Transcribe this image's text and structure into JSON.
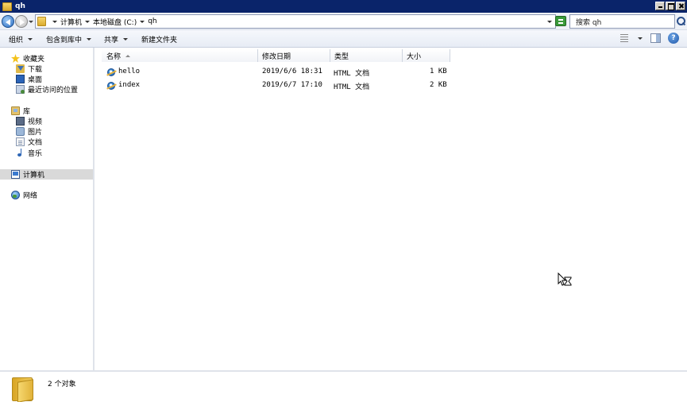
{
  "window": {
    "title": "qh"
  },
  "address": {
    "crumbs": [
      "计算机",
      "本地磁盘 (C:)",
      "qh"
    ]
  },
  "search": {
    "placeholder": "搜索 qh"
  },
  "toolbar": {
    "organize": "组织",
    "include_in_library": "包含到库中",
    "share": "共享",
    "new_folder": "新建文件夹",
    "help": "?"
  },
  "nav": {
    "favorites": "收藏夹",
    "downloads": "下载",
    "desktop": "桌面",
    "recent": "最近访问的位置",
    "libraries": "库",
    "videos": "视频",
    "pictures": "图片",
    "documents": "文档",
    "music": "音乐",
    "computer": "计算机",
    "network": "网络"
  },
  "columns": {
    "name": "名称",
    "date": "修改日期",
    "type": "类型",
    "size": "大小"
  },
  "files": [
    {
      "name": "hello",
      "date": "2019/6/6 18:31",
      "type": "HTML 文档",
      "size": "1 KB",
      "icon": "html-file-icon"
    },
    {
      "name": "index",
      "date": "2019/6/7 17:10",
      "type": "HTML 文档",
      "size": "2 KB",
      "icon": "html-file-icon"
    }
  ],
  "details": {
    "count": "2 个对象"
  },
  "colors": {
    "titlebar": "#0a246a",
    "selection": "#d9d9d9"
  }
}
